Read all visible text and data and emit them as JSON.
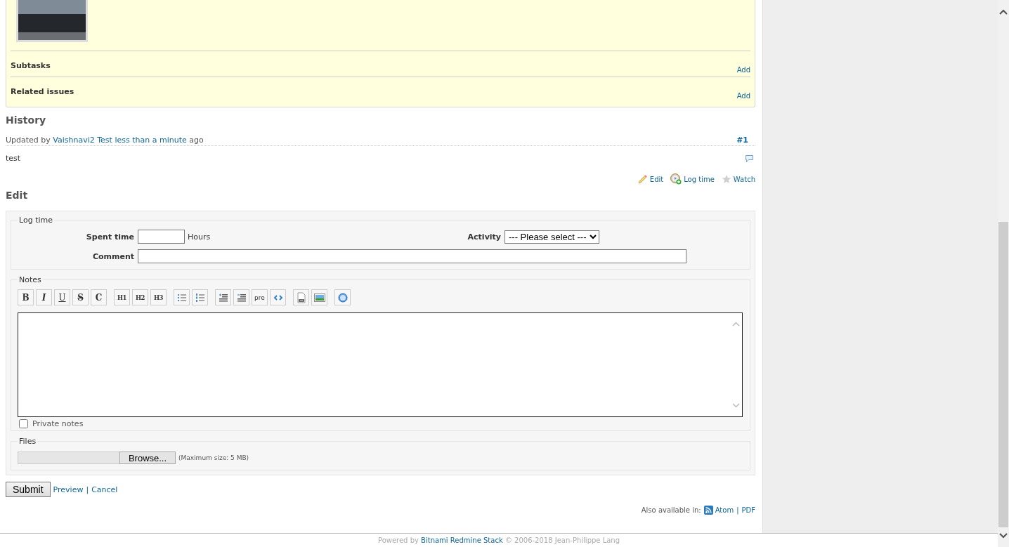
{
  "issue": {
    "sections": [
      {
        "title": "Subtasks",
        "action": "Add"
      },
      {
        "title": "Related issues",
        "action": "Add"
      }
    ]
  },
  "history": {
    "title": "History",
    "journals": [
      {
        "prefix": "Updated by",
        "author": "Vaishnavi2 Test",
        "time": "less than a minute",
        "suffix": "ago",
        "number": "#1",
        "note": "test"
      }
    ]
  },
  "issue_actions": [
    {
      "kind": "edit",
      "label": "Edit"
    },
    {
      "kind": "log_time",
      "label": "Log time"
    },
    {
      "kind": "watch",
      "label": "Watch"
    }
  ],
  "edit": {
    "title": "Edit",
    "log_time": {
      "legend": "Log time",
      "spent_time_label": "Spent time",
      "hours_unit": "Hours",
      "activity_label": "Activity",
      "activity_value": "--- Please select ---",
      "comment_label": "Comment"
    },
    "notes": {
      "legend": "Notes",
      "toolbar_groups": [
        [
          {
            "kind": "strong",
            "label": "B"
          },
          {
            "kind": "em",
            "label": "I"
          },
          {
            "kind": "ins",
            "label": "U"
          },
          {
            "kind": "del",
            "label": "S"
          },
          {
            "kind": "code",
            "label": "C"
          }
        ],
        [
          {
            "kind": "heading",
            "label": "H1"
          },
          {
            "kind": "heading",
            "label": "H2"
          },
          {
            "kind": "heading",
            "label": "H3"
          }
        ],
        [
          {
            "kind": "ul"
          },
          {
            "kind": "ol"
          }
        ],
        [
          {
            "kind": "bq"
          },
          {
            "kind": "unbq"
          },
          {
            "kind": "pre",
            "label": "pre"
          },
          {
            "kind": "precode"
          }
        ],
        [
          {
            "kind": "link"
          },
          {
            "kind": "img"
          }
        ],
        [
          {
            "kind": "help"
          }
        ]
      ],
      "private_notes": {
        "label": "Private notes",
        "checked": false
      }
    },
    "files": {
      "legend": "Files",
      "browse": "Browse...",
      "max_size": "(Maximum size: 5 MB)"
    },
    "submit": "Submit",
    "preview": "Preview",
    "separator": "|",
    "cancel": "Cancel"
  },
  "also_available": {
    "label": "Also available in:",
    "formats": [
      {
        "kind": "atom",
        "label": "Atom"
      },
      {
        "kind": "pdf",
        "label": "PDF"
      }
    ],
    "separator": "|"
  },
  "footer": {
    "powered_by": "Powered by",
    "product": "Bitnami Redmine Stack",
    "copyright": "© 2006-2018 Jean-Philippe Lang"
  }
}
